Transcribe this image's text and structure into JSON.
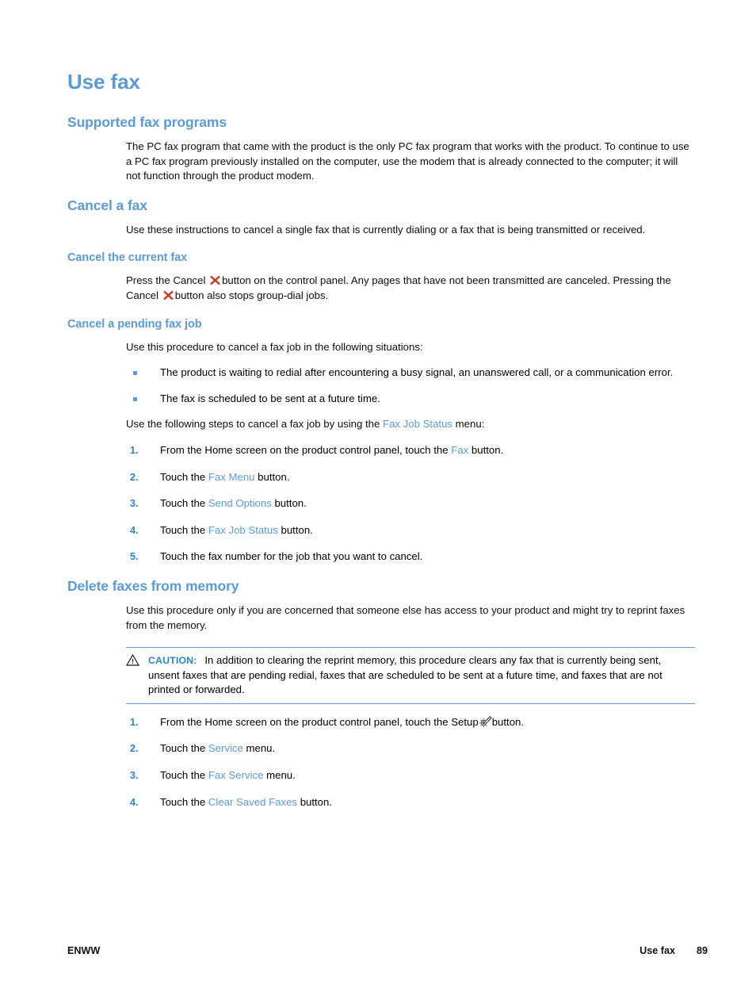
{
  "page": {
    "title": "Use fax",
    "heading_color": "#5B9BD5",
    "ui_term_color": "#5B9BD5",
    "cancel_icon_color": "#C8341F"
  },
  "sections": {
    "supported": {
      "heading": "Supported fax programs",
      "paragraph": "The PC fax program that came with the product is the only PC fax program that works with the product. To continue to use a PC fax program previously installed on the computer, use the modem that is already connected to the computer; it will not function through the product modem."
    },
    "cancel_fax": {
      "heading": "Cancel a fax",
      "paragraph": "Use these instructions to cancel a single fax that is currently dialing or a fax that is being transmitted or received."
    },
    "cancel_current": {
      "heading": "Cancel the current fax",
      "text_a": "Press the Cancel",
      "text_b": "button on the control panel. Any pages that have not been transmitted are canceled. Pressing the Cancel",
      "text_c": "button also stops group-dial jobs."
    },
    "cancel_pending": {
      "heading": "Cancel a pending fax job",
      "intro": "Use this procedure to cancel a fax job in the following situations:",
      "bullets": [
        "The product is waiting to redial after encountering a busy signal, an unanswered call, or a communication error.",
        "The fax is scheduled to be sent at a future time."
      ],
      "steps_intro_a": "Use the following steps to cancel a fax job by using the",
      "steps_intro_term": "Fax Job Status",
      "steps_intro_b": "menu:",
      "steps": [
        {
          "num": "1.",
          "before": "From the Home screen on the product control panel, touch the",
          "term": "Fax",
          "after": "button."
        },
        {
          "num": "2.",
          "before": "Touch the",
          "term": "Fax Menu",
          "after": "button."
        },
        {
          "num": "3.",
          "before": "Touch the",
          "term": "Send Options",
          "after": "button."
        },
        {
          "num": "4.",
          "before": "Touch the",
          "term": "Fax Job Status",
          "after": "button."
        },
        {
          "num": "5.",
          "before": "Touch the fax number for the job that you want to cancel.",
          "term": "",
          "after": ""
        }
      ]
    },
    "delete_faxes": {
      "heading": "Delete faxes from memory",
      "paragraph": "Use this procedure only if you are concerned that someone else has access to your product and might try to reprint faxes from the memory.",
      "caution": {
        "label": "CAUTION:",
        "text": "In addition to clearing the reprint memory, this procedure clears any fax that is currently being sent, unsent faxes that are pending redial, faxes that are scheduled to be sent at a future time, and faxes that are not printed or forwarded."
      },
      "steps": [
        {
          "num": "1.",
          "before": "From the Home screen on the product control panel, touch the Setup",
          "term": "",
          "after": "button."
        },
        {
          "num": "2.",
          "before": "Touch the",
          "term": "Service",
          "after": "menu."
        },
        {
          "num": "3.",
          "before": "Touch the",
          "term": "Fax Service",
          "after": "menu."
        },
        {
          "num": "4.",
          "before": "Touch the",
          "term": "Clear Saved Faxes",
          "after": "button."
        }
      ]
    }
  },
  "footer": {
    "left": "ENWW",
    "chapter": "Use fax",
    "page_number": "89"
  }
}
